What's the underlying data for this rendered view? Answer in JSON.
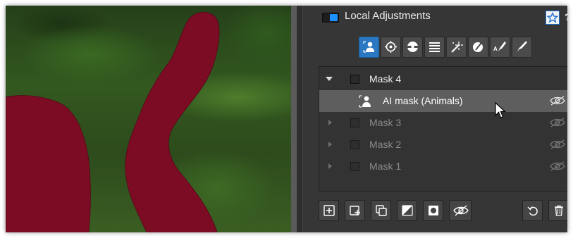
{
  "panel": {
    "title": "Local Adjustments",
    "help_label": "?",
    "accent_color": "#1e8fff",
    "mask_color": "#7c0c24",
    "toggle_on": true
  },
  "mode_tools": [
    {
      "name": "ai-mask-mode",
      "icon": "person-select-icon",
      "active": true
    },
    {
      "name": "control-point-mode",
      "icon": "target-icon",
      "active": false
    },
    {
      "name": "luminosity-mask-mode",
      "icon": "sphere-icon",
      "active": false
    },
    {
      "name": "gradient-mode",
      "icon": "horizontal-lines-icon",
      "active": false
    },
    {
      "name": "magic-brush-mode",
      "icon": "magic-wand-icon",
      "active": false
    },
    {
      "name": "color-picker-mode",
      "icon": "dropper-icon",
      "active": false
    },
    {
      "name": "text-brush-mode",
      "icon": "text-brush-icon",
      "active": false
    },
    {
      "name": "brush-mode",
      "icon": "brush-icon",
      "active": false
    }
  ],
  "masks": [
    {
      "label": "Mask 4",
      "expanded": true,
      "children": [
        {
          "label": "AI mask (Animals)",
          "selected": true
        }
      ]
    },
    {
      "label": "Mask 3",
      "expanded": false
    },
    {
      "label": "Mask 2",
      "expanded": false
    },
    {
      "label": "Mask 1",
      "expanded": false
    }
  ],
  "bottom_tools": [
    {
      "name": "add-mask",
      "icon": "plus-square-icon"
    },
    {
      "name": "add-sub-mask",
      "icon": "square-plus-corner-icon"
    },
    {
      "name": "duplicate-mask",
      "icon": "duplicate-icon"
    },
    {
      "name": "invert-mask",
      "icon": "invert-icon"
    },
    {
      "name": "show-mask",
      "icon": "circle-square-icon"
    },
    {
      "name": "toggle-visibility",
      "icon": "eye-slash-icon"
    },
    {
      "name": "reset-mask",
      "icon": "undo-icon"
    },
    {
      "name": "delete-mask",
      "icon": "trash-icon"
    }
  ]
}
